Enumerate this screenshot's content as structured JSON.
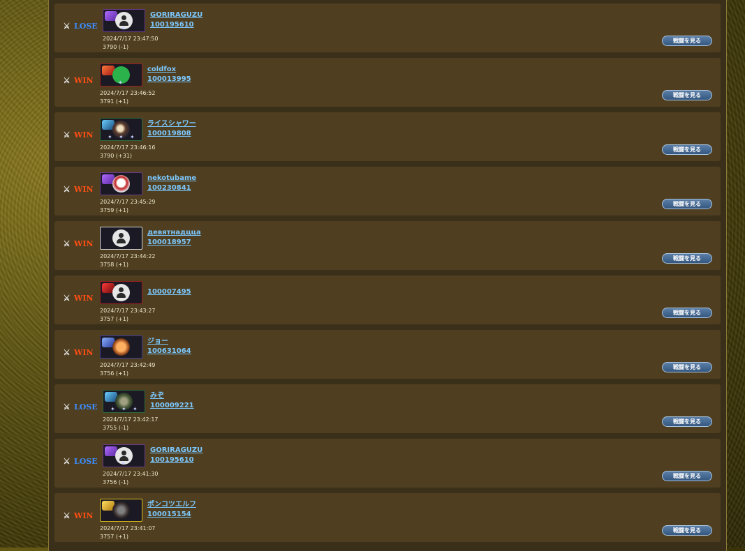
{
  "watch_button_label": "戦闘を見る",
  "colors": {
    "win": "#ff4e14",
    "lose": "#3c8dff",
    "link": "#7cc8ff",
    "row_bg": "#4f3f20"
  },
  "icons": {
    "result": "crossed-swords-icon",
    "avatar": "default-person-icon"
  },
  "matches": [
    {
      "result": "LOSE",
      "name": "GORIRAGUZU",
      "id": "100195610",
      "datetime": "2024/7/17 23:47:50",
      "rating": "3790 (-1)"
    },
    {
      "result": "WIN",
      "name": "coldfox",
      "id": "100013995",
      "datetime": "2024/7/17 23:46:52",
      "rating": "3791 (+1)"
    },
    {
      "result": "WIN",
      "name": "ライスシャワー",
      "id": "100019808",
      "datetime": "2024/7/17 23:46:16",
      "rating": "3790 (+31)"
    },
    {
      "result": "WIN",
      "name": "nekotubame",
      "id": "100230841",
      "datetime": "2024/7/17 23:45:29",
      "rating": "3759 (+1)"
    },
    {
      "result": "WIN",
      "name": "девятнадцца",
      "id": "100018957",
      "datetime": "2024/7/17 23:44:22",
      "rating": "3758 (+1)"
    },
    {
      "result": "WIN",
      "name": "",
      "id": "100007495",
      "datetime": "2024/7/17 23:43:27",
      "rating": "3757 (+1)"
    },
    {
      "result": "WIN",
      "name": "ジョー",
      "id": "100631064",
      "datetime": "2024/7/17 23:42:49",
      "rating": "3756 (+1)"
    },
    {
      "result": "LOSE",
      "name": "みぞ",
      "id": "100009221",
      "datetime": "2024/7/17 23:42:17",
      "rating": "3755 (-1)"
    },
    {
      "result": "LOSE",
      "name": "GORIRAGUZU",
      "id": "100195610",
      "datetime": "2024/7/17 23:41:30",
      "rating": "3756 (-1)"
    },
    {
      "result": "WIN",
      "name": "ポンコツエルフ",
      "id": "100015154",
      "datetime": "2024/7/17 23:41:07",
      "rating": "3757 (+1)"
    }
  ]
}
